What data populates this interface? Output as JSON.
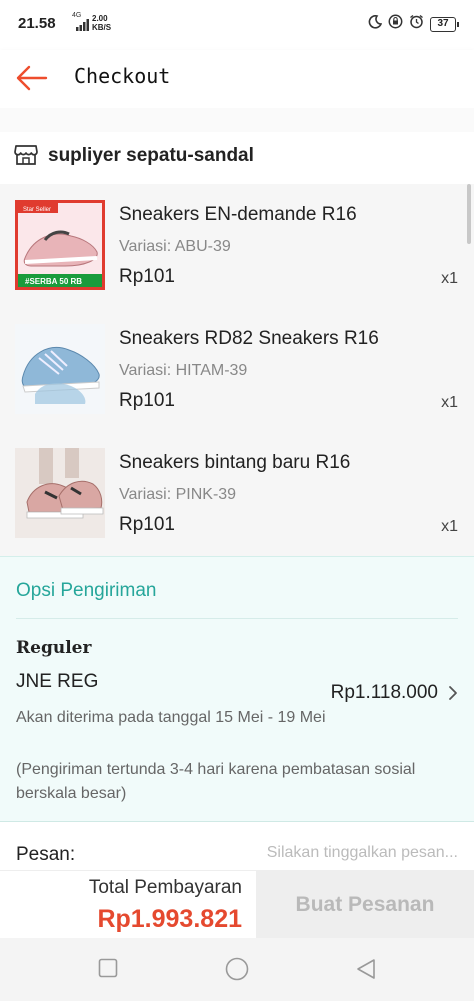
{
  "status_bar": {
    "time": "21.58",
    "network": "4G",
    "speed_value": "2.00",
    "speed_unit": "KB/S",
    "battery": "37"
  },
  "header": {
    "title": "Checkout"
  },
  "seller": {
    "icon": "shop-icon",
    "name": "supliyer sepatu-sandal"
  },
  "products": [
    {
      "name": "Sneakers EN-demande R16",
      "variant": "Variasi: ABU-39",
      "price": "Rp101",
      "qty": "x1",
      "thumb_badge": "#SERBA 50 RB",
      "thumb_tag": "Star Seller",
      "thumb_color": "#e8b4b8"
    },
    {
      "name": "Sneakers RD82 Sneakers R16",
      "variant": "Variasi: HITAM-39",
      "price": "Rp101",
      "qty": "x1",
      "thumb_color": "#8fb8d8"
    },
    {
      "name": "Sneakers bintang baru R16",
      "variant": "Variasi: PINK-39",
      "price": "Rp101",
      "qty": "x1",
      "thumb_color": "#d9a7a3"
    }
  ],
  "shipping": {
    "section_title": "Opsi Pengiriman",
    "method": "Reguler",
    "courier": "JNE REG",
    "price": "Rp1.118.000",
    "eta": "Akan diterima pada tanggal 15 Mei - 19 Mei",
    "note": "(Pengiriman tertunda 3-4 hari karena pembatasan sosial berskala besar)"
  },
  "message": {
    "label": "Pesan:",
    "placeholder": "Silakan tinggalkan pesan..."
  },
  "footer": {
    "total_label": "Total Pembayaran",
    "total_amount": "Rp1.993.821",
    "order_button": "Buat Pesanan"
  },
  "colors": {
    "accent": "#ee4d2d",
    "total_price": "#e5492f",
    "shipping_title": "#26a69a",
    "shipping_bg": "#f1fbfa"
  }
}
